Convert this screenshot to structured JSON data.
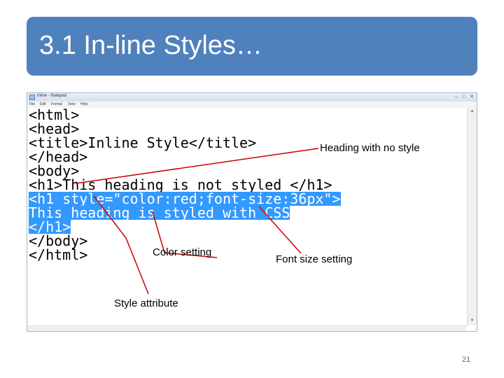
{
  "slide": {
    "title": "3.1 In-line Styles…",
    "number": "21"
  },
  "notepad": {
    "window_title": "inline - Notepad",
    "menu": [
      "File",
      "Edit",
      "Format",
      "View",
      "Help"
    ],
    "window_controls": [
      "minimize-icon",
      "maximize-icon",
      "close-icon"
    ],
    "code_lines": [
      "<html>",
      "<head>",
      "<title>Inline Style</title>",
      "</head>",
      "<body>",
      "<h1>This heading is not styled </h1>",
      "<h1 style=\"color:red;font-size:36px\">",
      "This heading is styled with CSS",
      "</h1>",
      "</body>",
      "</html>"
    ],
    "selected_lines": [
      6,
      7,
      8
    ],
    "selection_color": "#3399ff"
  },
  "annotations": {
    "no_style": "Heading with no style",
    "color_setting": "Color setting",
    "font_size_setting": "Font size setting",
    "style_attribute": "Style attribute",
    "arrow_color": "#cc0000"
  },
  "colors": {
    "banner": "#4f81bd",
    "banner_text": "#ffffff"
  }
}
